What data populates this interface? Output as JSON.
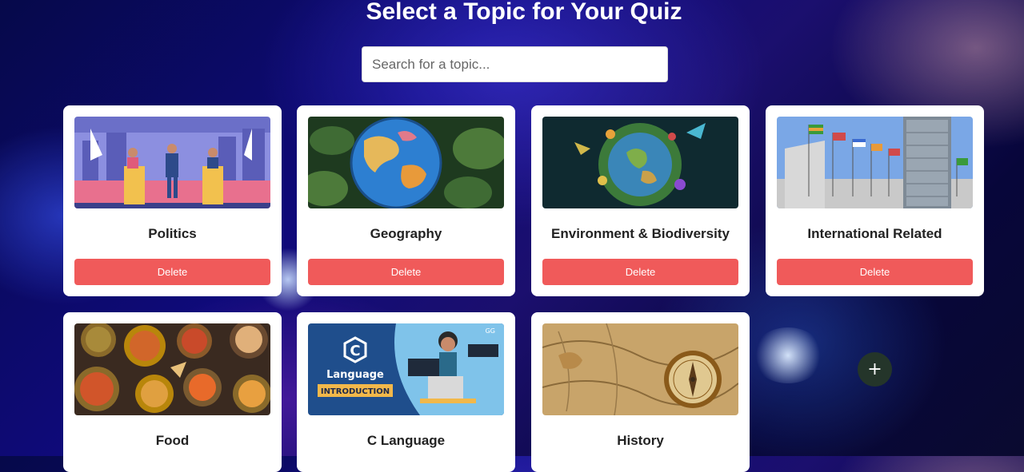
{
  "page": {
    "title": "Select a Topic for Your Quiz"
  },
  "search": {
    "placeholder": "Search for a topic...",
    "value": ""
  },
  "topics": [
    {
      "name": "Politics",
      "delete_label": "Delete"
    },
    {
      "name": "Geography",
      "delete_label": "Delete"
    },
    {
      "name": "Environment & Biodiversity",
      "delete_label": "Delete"
    },
    {
      "name": "International Related",
      "delete_label": "Delete"
    },
    {
      "name": "Food"
    },
    {
      "name": "C Language",
      "image_text": {
        "letter": "C",
        "line1": "Language",
        "line2": "INTRODUCTION",
        "brand": "GG"
      }
    },
    {
      "name": "History"
    }
  ],
  "add_button": {
    "label": "+"
  },
  "colors": {
    "delete": "#f05a5a",
    "add_button": "#24352a",
    "card": "#ffffff"
  },
  "icons": {
    "add": "plus-icon"
  }
}
